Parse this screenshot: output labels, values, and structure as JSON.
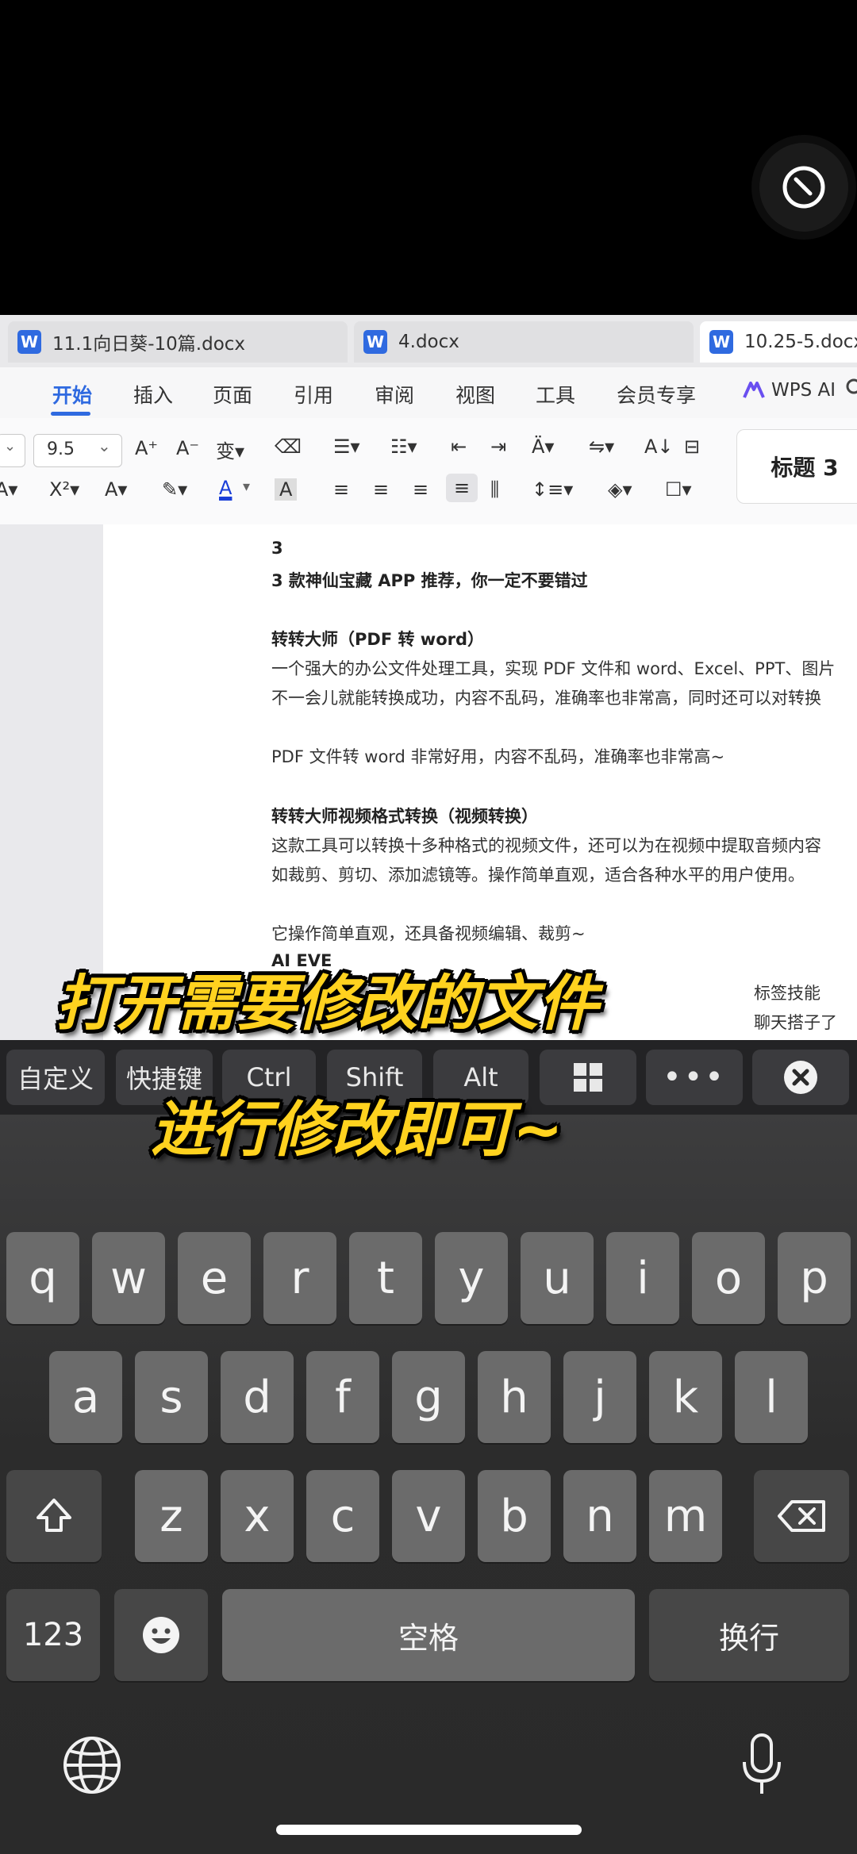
{
  "tabs": [
    {
      "label": "11.1向日葵-10篇.docx",
      "active": false
    },
    {
      "label": "4.docx",
      "active": false
    },
    {
      "label": "10.25-5.docx",
      "active": true
    }
  ],
  "menu": [
    "开始",
    "插入",
    "页面",
    "引用",
    "审阅",
    "视图",
    "工具",
    "会员专享"
  ],
  "wps_ai": "WPS AI",
  "ribbon": {
    "font_size": "9.5",
    "style_preview": "标题 3"
  },
  "doc_lines": [
    {
      "text": "3",
      "bold": true
    },
    {
      "text": "3 款神仙宝藏 APP 推荐，你一定不要错过",
      "bold": true
    },
    {
      "text": "",
      "bold": false
    },
    {
      "text": "转转大师（PDF 转 word）",
      "bold": true
    },
    {
      "text": "一个强大的办公文件处理工具，实现 PDF 文件和 word、Excel、PPT、图片",
      "bold": false
    },
    {
      "text": "不一会儿就能转换成功，内容不乱码，准确率也非常高，同时还可以对转换",
      "bold": false
    },
    {
      "text": "",
      "bold": false
    },
    {
      "text": "PDF 文件转 word 非常好用，内容不乱码，准确率也非常高~",
      "bold": false
    },
    {
      "text": "",
      "bold": false
    },
    {
      "text": "转转大师视频格式转换（视频转换）",
      "bold": true
    },
    {
      "text": "这款工具可以转换十多种格式的视频文件，还可以为在视频中提取音频内容",
      "bold": false
    },
    {
      "text": "如裁剪、剪切、添加滤镜等。操作简单直观，适合各种水平的用户使用。",
      "bold": false
    },
    {
      "text": "",
      "bold": false
    },
    {
      "text": "它操作简单直观，还具备视频编辑、裁剪~",
      "bold": false
    },
    {
      "text": "AI EVE",
      "bold": true
    }
  ],
  "doc_partial_right": [
    "标签技能",
    "聊天搭子了"
  ],
  "accessory_bar": [
    "自定义",
    "快捷键",
    "Ctrl",
    "Shift",
    "Alt"
  ],
  "keyboard": {
    "row1": [
      "q",
      "w",
      "e",
      "r",
      "t",
      "y",
      "u",
      "i",
      "o",
      "p"
    ],
    "row2": [
      "a",
      "s",
      "d",
      "f",
      "g",
      "h",
      "j",
      "k",
      "l"
    ],
    "row3": [
      "z",
      "x",
      "c",
      "v",
      "b",
      "n",
      "m"
    ],
    "num_key": "123",
    "space": "空格",
    "return": "换行"
  },
  "captions": [
    "打开需要修改的文件",
    "进行修改即可~"
  ],
  "colors": {
    "caption": "#ffd21f",
    "accent": "#2f6ae0"
  }
}
